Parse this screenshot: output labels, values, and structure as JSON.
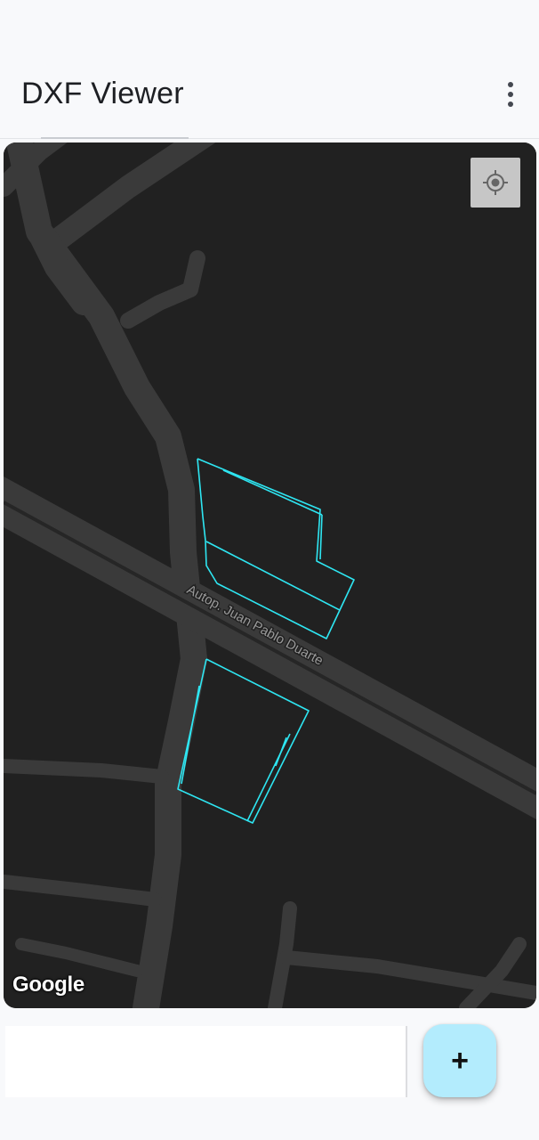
{
  "app_bar": {
    "title": "DXF Viewer",
    "menu_icon": "more-vert-icon"
  },
  "map": {
    "theme": "dark",
    "road_label": "Autop. Juan Pablo Duarte",
    "attribution": "Google",
    "locate_icon": "my-location-icon",
    "overlay_color": "#2ee6f2",
    "background_color": "#212121",
    "road_color": "#3a3a3a"
  },
  "fab": {
    "icon": "add-icon",
    "symbol": "+",
    "color": "#b3ecfd"
  }
}
